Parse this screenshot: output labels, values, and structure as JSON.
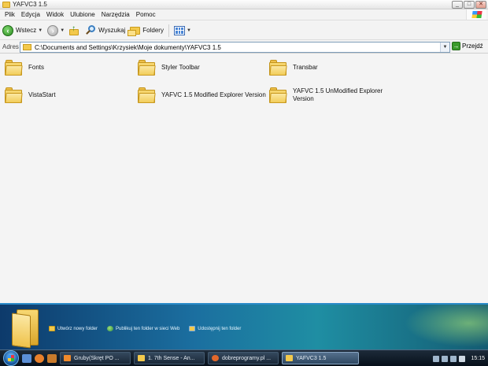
{
  "window": {
    "title": "YAFVC3 1.5",
    "controls": {
      "minimize": "_",
      "maximize": "□",
      "close": "✕"
    }
  },
  "menu": [
    "Plik",
    "Edycja",
    "Widok",
    "Ulubione",
    "Narzędzia",
    "Pomoc"
  ],
  "toolbar": {
    "back_label": "Wstecz",
    "search_label": "Wyszukaj",
    "folders_label": "Foldery"
  },
  "address": {
    "label": "Adres",
    "value": "C:\\Documents and Settings\\Krzysiek\\Moje dokumenty\\YAFVC3 1.5",
    "go_label": "Przejdź"
  },
  "folders": [
    {
      "name": "Fonts"
    },
    {
      "name": "Styler Toolbar"
    },
    {
      "name": "Transbar"
    },
    {
      "name": "VistaStart"
    },
    {
      "name": "YAFVC 1.5 Modified Explorer Version"
    },
    {
      "name": "YAFVC 1.5 UnModified Explorer Version"
    }
  ],
  "tasks": [
    {
      "label": "Utwórz nowy folder",
      "icon": "new-folder-icon"
    },
    {
      "label": "Publikuj ten folder w sieci Web",
      "icon": "globe-icon"
    },
    {
      "label": "Udostępnij ten folder",
      "icon": "share-folder-icon"
    }
  ],
  "taskbar": {
    "items": [
      {
        "label": "Gruby(Skręt PO ..."
      },
      {
        "label": "1. 7th Sense - An..."
      },
      {
        "label": "dobreprogramy.pl ..."
      },
      {
        "label": "YAFVC3 1.5",
        "active": true
      }
    ],
    "clock": "15:15"
  },
  "colors": {
    "folder_yellow": "#f3c94c",
    "taskpane_blue": "#1b6fa0",
    "taskbar_dark": "#07101a"
  }
}
